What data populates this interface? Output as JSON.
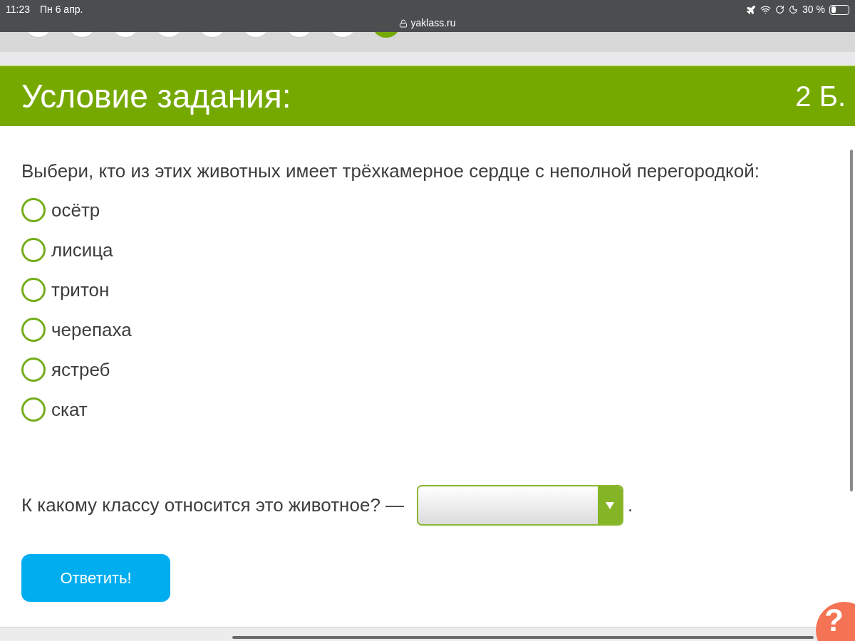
{
  "status_bar": {
    "time": "11:23",
    "date": "Пн 6 апр.",
    "url": "yaklass.ru",
    "battery": "30 %"
  },
  "task_nav": [
    {
      "selected": false
    },
    {
      "selected": false
    },
    {
      "selected": false
    },
    {
      "selected": false
    },
    {
      "selected": false
    },
    {
      "selected": false
    },
    {
      "selected": false
    },
    {
      "selected": false
    },
    {
      "selected": true
    }
  ],
  "header": {
    "title": "Условие задания:",
    "points": "2 Б."
  },
  "question": "Выбери, кто из этих животных имеет трёхкамерное сердце с неполной перегородкой:",
  "options": [
    {
      "label": "осётр",
      "selected": false
    },
    {
      "label": "лисица",
      "selected": false
    },
    {
      "label": "тритон",
      "selected": false
    },
    {
      "label": "черепаха",
      "selected": false
    },
    {
      "label": "ястреб",
      "selected": false
    },
    {
      "label": "скат",
      "selected": false
    }
  ],
  "followup": {
    "text": "К какому классу относится это животное? —",
    "after": "."
  },
  "submit": "Ответить!",
  "help": "?"
}
